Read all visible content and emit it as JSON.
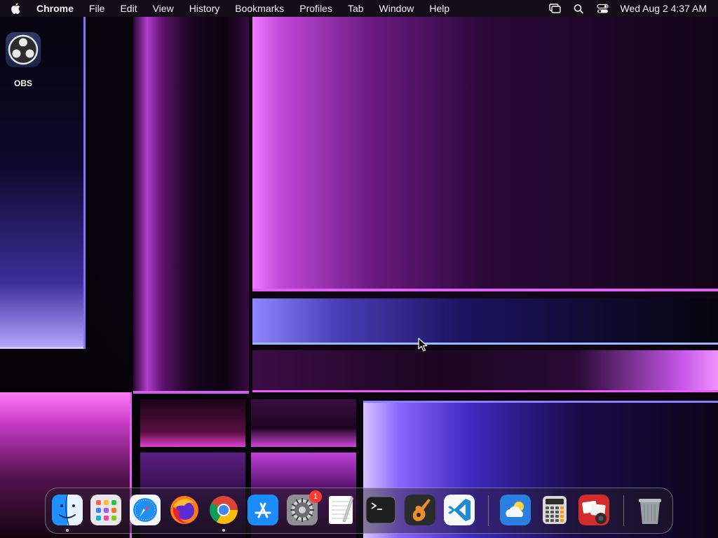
{
  "menubar": {
    "apple_icon": "apple-logo-icon",
    "app_name": "Chrome",
    "menus": [
      "File",
      "Edit",
      "View",
      "History",
      "Bookmarks",
      "Profiles",
      "Tab",
      "Window",
      "Help"
    ],
    "status_icons": [
      "screen-mirroring-icon",
      "spotlight-search-icon",
      "control-center-icon"
    ],
    "clock": "Wed Aug 2  4:37 AM"
  },
  "desktop": {
    "icons": [
      {
        "label": "OBS",
        "icon": "obs-studio-icon"
      }
    ]
  },
  "dock": {
    "apps": [
      {
        "name": "Finder",
        "icon": "finder-icon",
        "running": true
      },
      {
        "name": "Launchpad",
        "icon": "launchpad-icon",
        "running": false
      },
      {
        "name": "Safari",
        "icon": "safari-icon",
        "running": false
      },
      {
        "name": "Firefox",
        "icon": "firefox-icon",
        "running": false
      },
      {
        "name": "Google Chrome",
        "icon": "chrome-icon",
        "running": true
      },
      {
        "name": "App Store",
        "icon": "app-store-icon",
        "running": false
      },
      {
        "name": "System Settings",
        "icon": "system-settings-icon",
        "running": false,
        "badge": "1"
      },
      {
        "name": "TextEdit",
        "icon": "textedit-icon",
        "running": false
      },
      {
        "name": "Terminal",
        "icon": "terminal-icon",
        "running": false
      },
      {
        "name": "GarageBand",
        "icon": "garageband-icon",
        "running": false
      },
      {
        "name": "Visual Studio Code",
        "icon": "vscode-icon",
        "running": false
      },
      {
        "name": "Weather",
        "icon": "weather-icon",
        "running": false
      },
      {
        "name": "Calculator",
        "icon": "calculator-icon",
        "running": false
      },
      {
        "name": "Photo Booth",
        "icon": "photo-booth-icon",
        "running": false
      },
      {
        "name": "Trash",
        "icon": "trash-icon",
        "running": false
      }
    ]
  },
  "colors": {
    "badge": "#ff3b30",
    "wallpaper_accent": "#e060f5"
  }
}
